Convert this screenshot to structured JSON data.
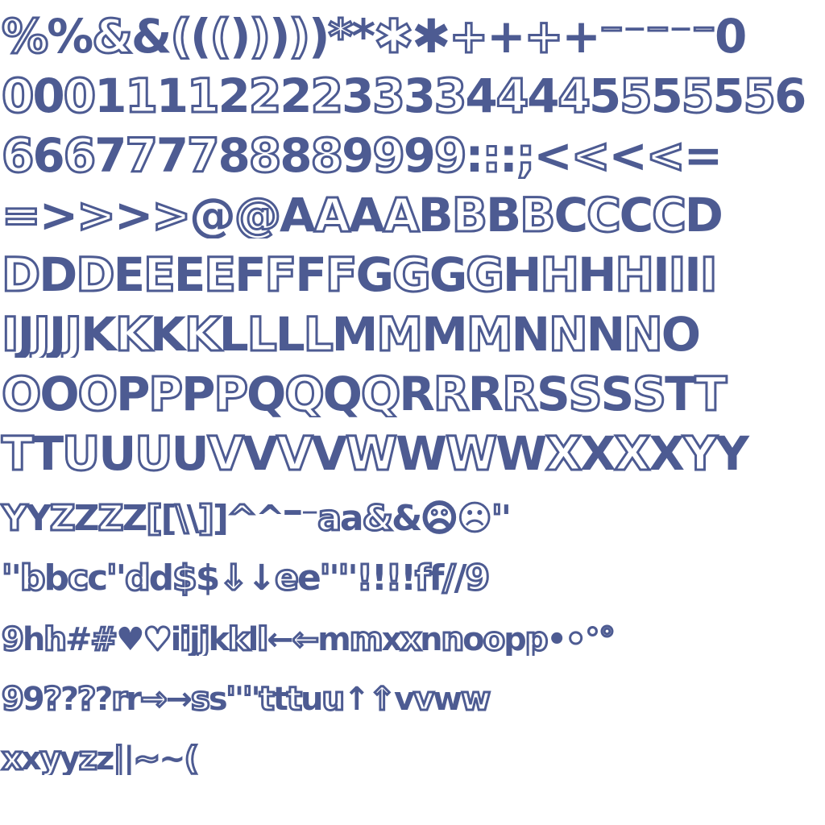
{
  "style": {
    "ink_color": "#4d5b92",
    "outline_fill": "#ffffff",
    "background": "#ffffff"
  },
  "rows": [
    {
      "name": "row-1",
      "text": "%%&&((()))))**✱✱++++⁻⁻⁻⁻⁻0",
      "variant": "normal"
    },
    {
      "name": "row-2",
      "text": "00011112222333344445555556",
      "variant": "normal"
    },
    {
      "name": "row-3",
      "text": "666777788889999:::;<<<<=",
      "variant": "normal"
    },
    {
      "name": "row-4",
      "text": "=>>>>@@AAAABBBBCCCCD",
      "variant": "normal"
    },
    {
      "name": "row-5",
      "text": "DDDEEEEFFFFGGGGHHHHIIII",
      "variant": "normal"
    },
    {
      "name": "row-6",
      "text": "IJJJJKKKKLLLLMMMMNNNNO",
      "variant": "normal"
    },
    {
      "name": "row-7",
      "text": "OOOPPPPQQQQRRRRSSSSTT",
      "variant": "normal"
    },
    {
      "name": "row-8",
      "text": "TTUUUUVVVVWWWWXXXXYY",
      "variant": "normal"
    },
    {
      "name": "row-9",
      "text": "YYZZZZ[[\\\\]]^^⁻⁻aa&&☹☹''",
      "variant": "small"
    },
    {
      "name": "row-10",
      "text": "''bbcc''dd$$↓↓ee''''!!!!ff//9",
      "variant": "small"
    },
    {
      "name": "row-11",
      "text": "9hh##♥♥iijjkkll←←mmxxnnoopp••°°",
      "variant": "smaller"
    },
    {
      "name": "row-12",
      "text": "99????rr→→ss''''tttuu↑↑vvww",
      "variant": "smaller"
    },
    {
      "name": "row-13",
      "text": "xxyyzz||~~(",
      "variant": "smaller"
    }
  ]
}
